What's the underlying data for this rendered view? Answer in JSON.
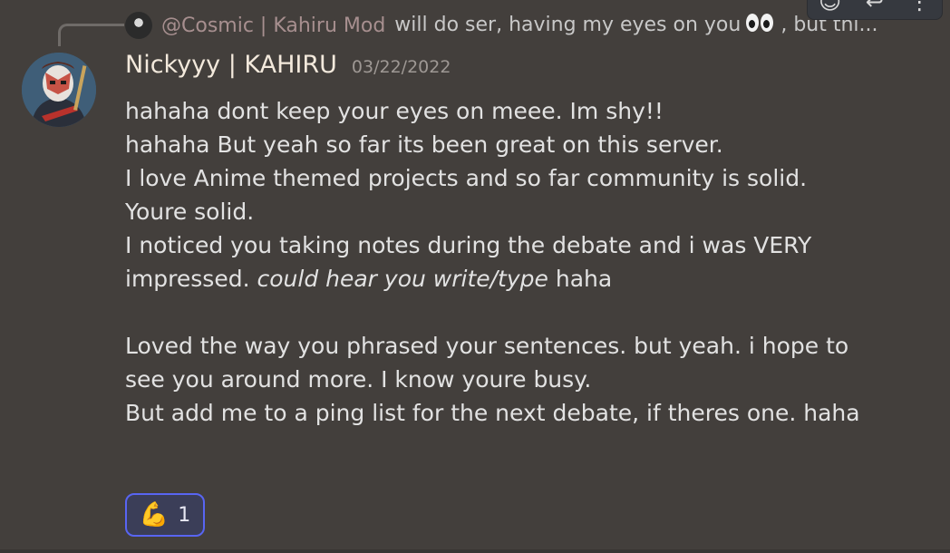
{
  "reply": {
    "author": "@Cosmic | Kahiru Mod",
    "text_before_emoji": "will do ser, having my eyes on you",
    "text_after_emoji": ", but thi..."
  },
  "toolbar": {
    "icons": [
      "add-reaction-icon",
      "reply-icon",
      "more-options-icon"
    ],
    "add_reaction_glyph": "☺",
    "reply_glyph": "↩",
    "more_glyph": "⋮"
  },
  "message": {
    "username": "Nickyyy | KAHIRU",
    "timestamp": "03/22/2022",
    "lines": [
      "hahaha dont keep your eyes on meee. Im shy!!",
      "hahaha But yeah so far its been great on this server.",
      "I love Anime themed projects and so far community is solid.",
      "Youre solid.",
      "I noticed you taking notes during the debate and i was VERY",
      "",
      "",
      "Loved the way you phrased your sentences. but yeah. i hope to",
      "see you around more. I know youre busy.",
      "But add me to a ping list for the next debate, if theres one. haha"
    ],
    "line6_prefix": "impressed.  ",
    "line6_italic": "could hear you write/type",
    "line6_suffix": " haha"
  },
  "reaction": {
    "emoji": "💪",
    "count": "1"
  },
  "colors": {
    "background": "#433f3c",
    "reaction_border": "#5865f2",
    "reply_author": "#a78f8f"
  }
}
